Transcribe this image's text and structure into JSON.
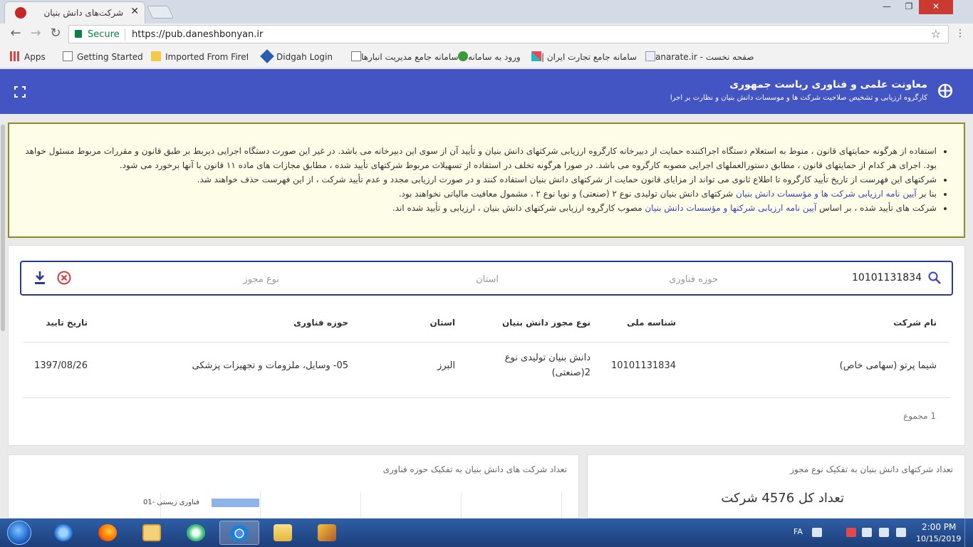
{
  "browser": {
    "tab_title": "شرکت‌های دانش بنیان",
    "secure_label": "Secure",
    "url": "https://pub.daneshbonyan.ir",
    "bookmarks": [
      "Apps",
      "Getting Started",
      "Imported From Firefc",
      "Didgah Login",
      "سامانه جامع مدیریت انبارها",
      "ورود به سامانه",
      "سامانه جامع تجارت ایران |",
      "صفحه نخست - anarate.ir"
    ]
  },
  "header": {
    "title": "معاونت علمی و فناوری ریاست جمهوری",
    "subtitle": "کارگروه ارزیابی و تشخیص صلاحیت شرکت ها و موسسات دانش بنیان و نظارت بر اجرا"
  },
  "notice": {
    "item1": "استفاده از هرگونه حمایتهای قانون ، منوط به استعلام دستگاه اجراکننده حمایت از دبیرخانه کارگروه ارزیابی شرکتهای دانش بنیان و تأیید آن از سوی این دبیرخانه می باشد. در غیر این صورت دستگاه اجرایی ذیربط بر طبق قانون و مقررات مربوط مسئول خواهد بود. اجرای هر کدام از حمایتهای قانون ، مطابق دستورالعملهای اجرایی مصوبه کارگروه می باشد. در صورا هرگونه تخلف در استفاده از تسهیلات مربوط شرکتهای تأیید شده ، مطابق مجازات های ماده ۱۱ قانون با آنها برخورد می شود.",
    "item2": "شرکتهای این فهرست از تاریخ تأیید کارگروه تا اطلاع ثانوی می تواند از مزایای قانون حمایت از شرکتهای دانش بنیان استفاده کنند و در صورت ارزیابی مجدد و عدم تأیید شرکت ، از این فهرست حذف خواهند شد.",
    "item3_pre": "بنا بر ",
    "item3_link": "آیین نامه ارزیابی شرکت ها و مؤسسات دانش بنیان",
    "item3_post": " شرکتهای دانش بنیان تولیدی نوع ۲ (صنعتی) و نوپا نوع ۲ ، مشمول معافیت مالیاتی نخواهند بود.",
    "item4_pre": "شرکت های تأیید شده ، بر اساس ",
    "item4_link": "آیین نامه ارزیابی شرکتها و مؤسسات دانش بنیان",
    "item4_post": " مصوب کارگروه ارزیابی شرکتهای دانش بنیان ، ارزیابی و تأیید شده اند."
  },
  "search": {
    "value": "10101131834",
    "tech_placeholder": "حوزه فناوری",
    "province_placeholder": "استان",
    "license_placeholder": "نوع مجوز"
  },
  "table": {
    "headers": {
      "name": "نام شرکت",
      "national_id": "شناسه ملی",
      "license_type": "نوع مجوز دانش بنیان",
      "province": "استان",
      "tech_field": "حوزه فناوری",
      "approval_date": "تاریخ تایید"
    },
    "rows": [
      {
        "name": "شیما پرتو (سهامی خاص)",
        "national_id": "10101131834",
        "license_line1": "دانش بنیان تولیدی نوع",
        "license_line2": "2(صنعتی)",
        "province": "البرز",
        "tech_field": "05- وسایل، ملزومات و تجهیزات پزشکی",
        "approval_date": "1397/08/26"
      }
    ],
    "total": "1 مجموع"
  },
  "charts": {
    "license_title": "تعداد شرکتهای دانش بنیان به تفکیک نوع مجوز",
    "total_count": "تعداد کل 4576 شرکت",
    "tech_title": "تعداد شرکت های دانش بنیان به تفکیک حوزه فناوری",
    "first_category": "فناوری زیستی -01"
  },
  "taskbar": {
    "lang": "FA",
    "time": "2:00 PM",
    "date": "10/15/2019"
  }
}
